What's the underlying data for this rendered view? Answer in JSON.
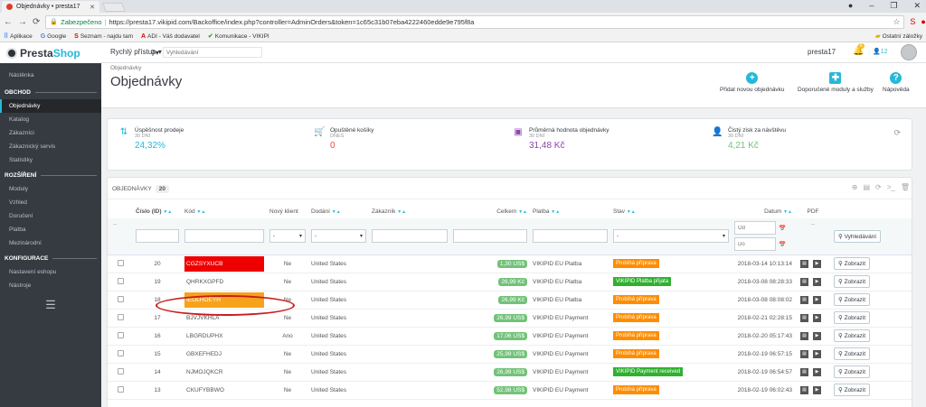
{
  "browser": {
    "tab_title": "Objednávky • presta17",
    "secure_label": "Zabezpečeno",
    "url": "https://presta17.vikipid.com/Backoffice/index.php?controller=AdminOrders&token=1c65c31b07eba4222460edde9e795f8a",
    "bookmarks": [
      "Aplikace",
      "Google",
      "Seznam - najdu tam",
      "ADI - Váš dodavatel",
      "Komunikace - VIKIPI"
    ],
    "other_bookmarks": "Ostatní záložky"
  },
  "app": {
    "logo_prefix": "Presta",
    "logo_suffix": "Shop",
    "quick_access": "Rychlý přístup",
    "search_placeholder": "Vyhledávání",
    "shop_name": "presta17",
    "bell_badge": "6",
    "customers_count": "12"
  },
  "sidebar": {
    "dashboard": "Nástěnka",
    "section_orders": "OBCHOD",
    "items_orders": [
      "Objednávky",
      "Katalog",
      "Zákazníci",
      "Zákaznický servis",
      "Statistiky"
    ],
    "section_ext": "ROZŠÍŘENÍ",
    "items_ext": [
      "Moduly",
      "Vzhled",
      "Doručení",
      "Platba",
      "Mezinárodní"
    ],
    "section_config": "KONFIGURACE",
    "items_config": [
      "Nastavení eshopu",
      "Nástroje"
    ]
  },
  "page": {
    "breadcrumb": "Objednávky",
    "title": "Objednávky",
    "toolbar": [
      "Přidat novou objednávku",
      "Doporučené moduly a služby",
      "Nápověda"
    ]
  },
  "kpi": [
    {
      "label": "Úspěšnost prodeje",
      "sub": "30 DNÍ",
      "value": "24,32%",
      "color": "#25b9d7"
    },
    {
      "label": "Opuštěné košíky",
      "sub": "DNES",
      "value": "0",
      "color": "#e74c3c"
    },
    {
      "label": "Průměrná hodnota objednávky",
      "sub": "30 DNÍ",
      "value": "31,48 Kč",
      "color": "#8e44ad"
    },
    {
      "label": "Čistý zisk za návštěvu",
      "sub": "30 DNÍ",
      "value": "4,21 Kč",
      "color": "#72c279"
    }
  ],
  "orders": {
    "panel_title": "OBJEDNÁVKY",
    "count": "20",
    "headers": [
      "Číslo (ID)",
      "Kód",
      "Nový klient",
      "Dodání",
      "Zákazník",
      "Celkem",
      "Platba",
      "Stav",
      "Datum",
      "PDF"
    ],
    "filter": {
      "select_default": "-",
      "date_from": "Od",
      "date_to": "Do",
      "search_button": "Vyhledávání",
      "dash": "--"
    },
    "view_label": "Zobrazit",
    "rows": [
      {
        "id": "20",
        "ref": "CGZSYXUCB",
        "ref_hl": "red",
        "new": "Ne",
        "country": "United States",
        "total": "1,30 US$",
        "payment": "VIKIPID EU Platba",
        "status": "Probíhá příprava",
        "status_type": "prep",
        "date": "2018-03-14 10:13:14"
      },
      {
        "id": "19",
        "ref": "QHRKXGPFD",
        "ref_hl": "",
        "new": "Ne",
        "country": "United States",
        "total": "26,99 Kč",
        "payment": "VIKIPID EU Platba",
        "status": "VIKIPID Platba přijata",
        "status_type": "ok",
        "date": "2018-03-08 08:28:33"
      },
      {
        "id": "18",
        "ref": "IEOLHOEYH",
        "ref_hl": "orange",
        "new": "Ne",
        "country": "United States",
        "total": "26,99 Kč",
        "payment": "VIKIPID EU Platba",
        "status": "Probíhá příprava",
        "status_type": "prep",
        "date": "2018-03-08 08:08:02"
      },
      {
        "id": "17",
        "ref": "BJVJVKHLA",
        "ref_hl": "",
        "new": "Ne",
        "country": "United States",
        "total": "26,99 US$",
        "payment": "VIKIPID EU Payment",
        "status": "Probíhá příprava",
        "status_type": "prep",
        "date": "2018-02-21 02:28:15"
      },
      {
        "id": "16",
        "ref": "LBGRDUPHX",
        "ref_hl": "",
        "new": "Ano",
        "country": "United States",
        "total": "17,06 US$",
        "payment": "VIKIPID EU Payment",
        "status": "Probíhá příprava",
        "status_type": "prep",
        "date": "2018-02-20 05:17:43"
      },
      {
        "id": "15",
        "ref": "GBXEFHEDJ",
        "ref_hl": "",
        "new": "Ne",
        "country": "United States",
        "total": "25,99 US$",
        "payment": "VIKIPID EU Payment",
        "status": "Probíhá příprava",
        "status_type": "prep",
        "date": "2018-02-19 06:57:15"
      },
      {
        "id": "14",
        "ref": "NJMOJQKCR",
        "ref_hl": "",
        "new": "Ne",
        "country": "United States",
        "total": "26,99 US$",
        "payment": "VIKIPID EU Payment",
        "status": "VIKIPID Payment received",
        "status_type": "ok",
        "date": "2018-02-19 06:54:57"
      },
      {
        "id": "13",
        "ref": "CKUFYBBWO",
        "ref_hl": "",
        "new": "Ne",
        "country": "United States",
        "total": "52,98 US$",
        "payment": "VIKIPID EU Payment",
        "status": "Probíhá příprava",
        "status_type": "prep",
        "date": "2018-02-19 06:02:43"
      }
    ]
  }
}
